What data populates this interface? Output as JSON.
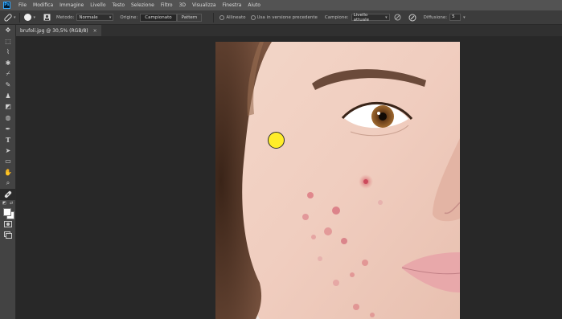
{
  "app": {
    "logo": "Ps"
  },
  "menu": [
    "File",
    "Modifica",
    "Immagine",
    "Livello",
    "Testo",
    "Selezione",
    "Filtro",
    "3D",
    "Visualizza",
    "Finestra",
    "Aiuto"
  ],
  "options": {
    "metodo_label": "Metodo:",
    "metodo_value": "Normale",
    "origine_label": "Origine:",
    "campionato": "Campionato",
    "pattern": "Pattern",
    "allineato": "Allineato",
    "usa_versione_precedente": "Usa in versione precedente",
    "campione_label": "Campione:",
    "campione_value": "Livello attuale",
    "diffusione_label": "Diffusione:",
    "diffusione_value": "5"
  },
  "document": {
    "tab_title": "brufoli.jpg @ 30,5% (RGB/8)",
    "close_glyph": "×"
  },
  "tools": [
    {
      "icon": "move-icon",
      "glyph": "✥"
    },
    {
      "icon": "marquee-icon",
      "glyph": "⬚"
    },
    {
      "icon": "lasso-icon",
      "glyph": "⌇"
    },
    {
      "icon": "magic-wand-icon",
      "glyph": "✱"
    },
    {
      "icon": "eyedropper-icon",
      "glyph": "⌿"
    },
    {
      "icon": "brush-icon",
      "glyph": "✎"
    },
    {
      "icon": "stamp-icon",
      "glyph": "♟"
    },
    {
      "icon": "eraser-icon",
      "glyph": "◩"
    },
    {
      "icon": "blur-icon",
      "glyph": "◍"
    },
    {
      "icon": "pen-icon",
      "glyph": "✒"
    },
    {
      "icon": "type-icon",
      "glyph": "T"
    },
    {
      "icon": "path-select-icon",
      "glyph": "➤"
    },
    {
      "icon": "shape-icon",
      "glyph": "▭"
    },
    {
      "icon": "hand-icon",
      "glyph": "✋"
    },
    {
      "icon": "zoom-icon",
      "glyph": "⌕"
    },
    {
      "icon": "healing-brush-icon",
      "glyph": "⊘",
      "active": true
    }
  ],
  "colors": {
    "foreground": "#ffffff",
    "background": "#ffffff",
    "accent": "#31a8ff",
    "cursor": "#ffed2a"
  }
}
